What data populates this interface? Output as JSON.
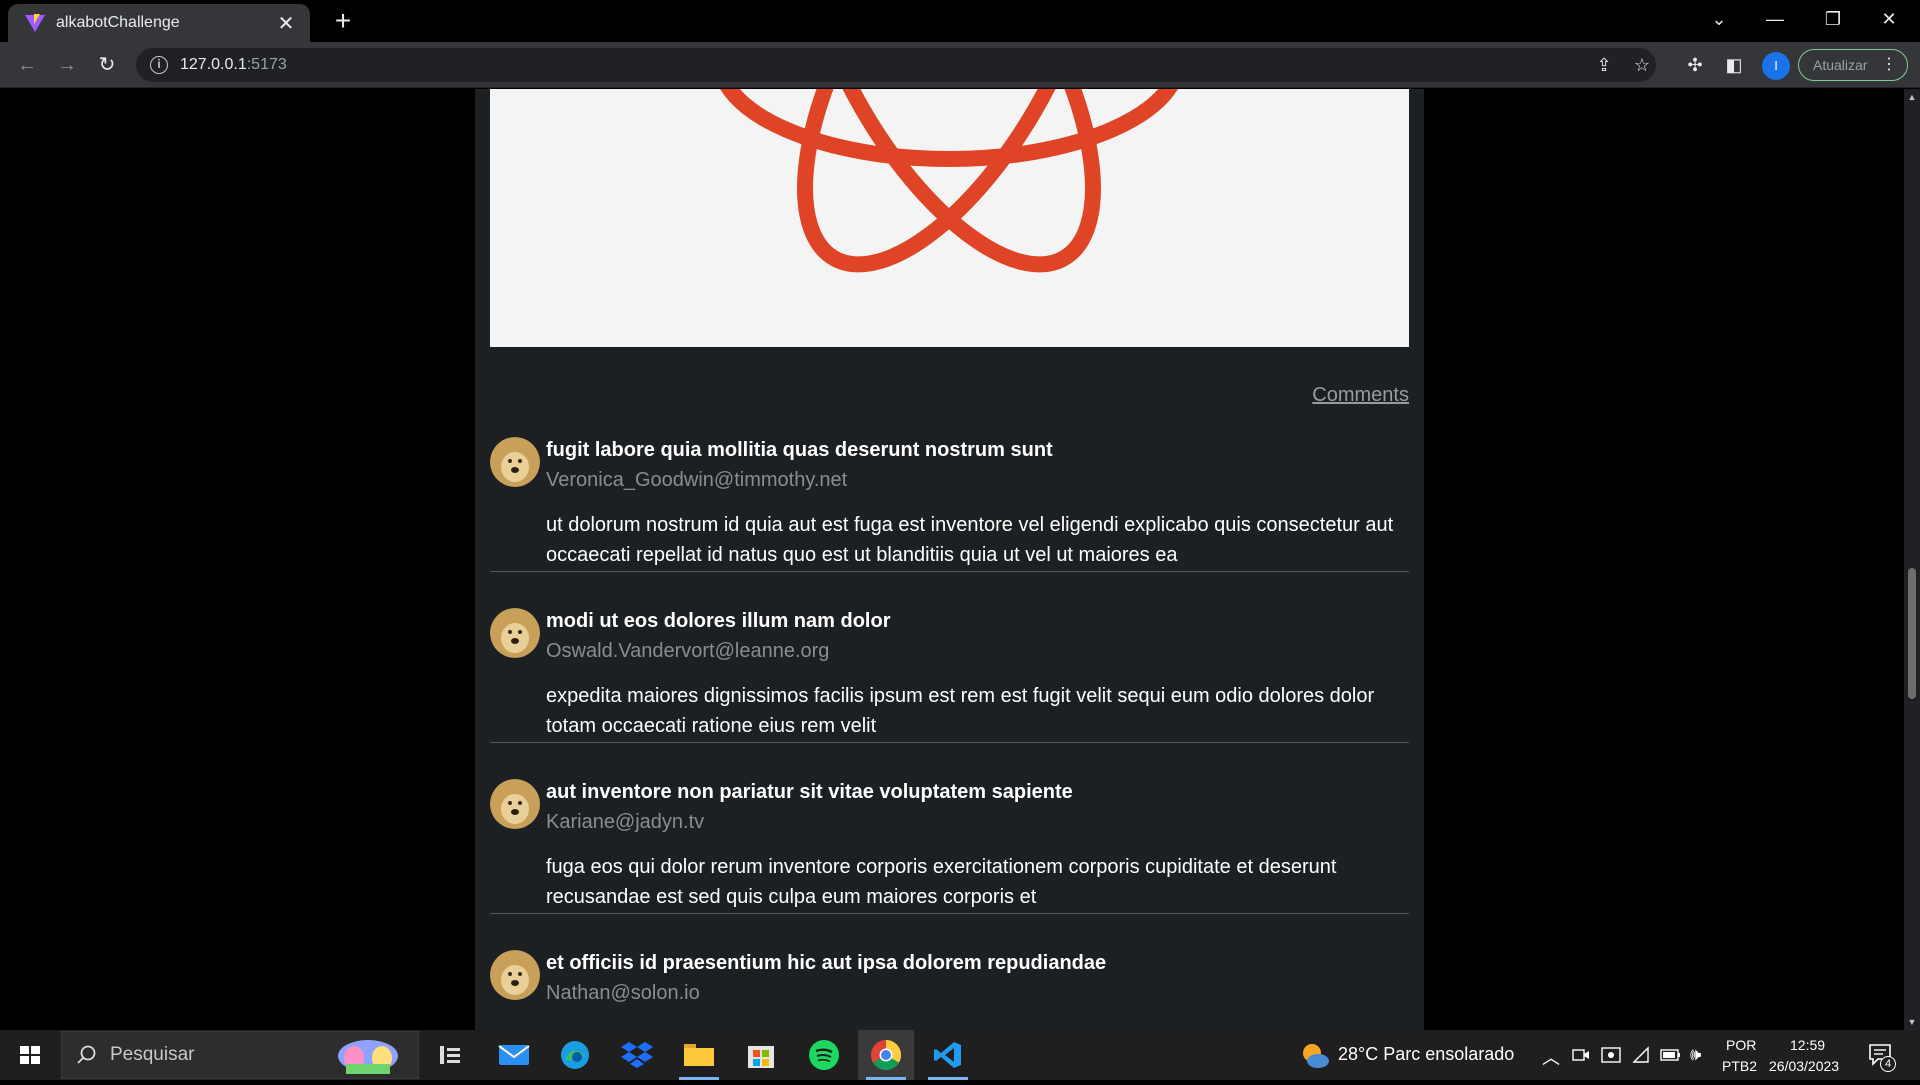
{
  "browser": {
    "tab_title": "alkabotChallenge",
    "url_host": "127.0.0.1",
    "url_port": ":5173",
    "update_label": "Atualizar",
    "profile_initial": "I"
  },
  "page": {
    "comments_link": "Comments",
    "comments": [
      {
        "name": "fugit labore quia mollitia quas deserunt nostrum sunt",
        "email": "Veronica_Goodwin@timmothy.net",
        "body": "ut dolorum nostrum id quia aut est fuga est inventore vel eligendi explicabo quis consectetur aut occaecati repellat id natus quo est ut blanditiis quia ut vel ut maiores ea"
      },
      {
        "name": "modi ut eos dolores illum nam dolor",
        "email": "Oswald.Vandervort@leanne.org",
        "body": "expedita maiores dignissimos facilis ipsum est rem est fugit velit sequi eum odio dolores dolor totam occaecati ratione eius rem velit"
      },
      {
        "name": "aut inventore non pariatur sit vitae voluptatem sapiente",
        "email": "Kariane@jadyn.tv",
        "body": "fuga eos qui dolor rerum inventore corporis exercitationem corporis cupiditate et deserunt recusandae est sed quis culpa eum maiores corporis et"
      },
      {
        "name": "et officiis id praesentium hic aut ipsa dolorem repudiandae",
        "email": "Nathan@solon.io",
        "body": ""
      }
    ]
  },
  "taskbar": {
    "search_placeholder": "Pesquisar",
    "weather": "28°C  Parc ensolarado",
    "language_top": "POR",
    "language_bottom": "PTB2",
    "time": "12:59",
    "date": "26/03/2023",
    "notifications": "4"
  },
  "colors": {
    "page_bg": "#000000",
    "card_bg": "#1c2023",
    "logo_red": "#e04427",
    "update_border": "#81c995"
  }
}
